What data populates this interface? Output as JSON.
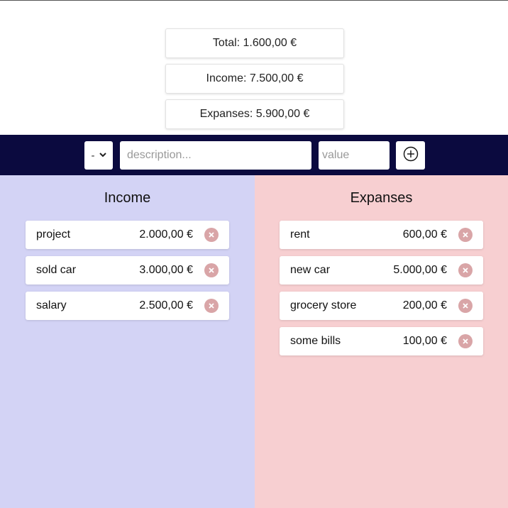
{
  "summary": {
    "total": "Total: 1.600,00 €",
    "income": "Income: 7.500,00 €",
    "expanses": "Expanses: 5.900,00 €"
  },
  "toolbar": {
    "type_selected": "-",
    "description_placeholder": "description...",
    "value_placeholder": "value",
    "add_icon": "plus-circle-icon"
  },
  "income": {
    "title": "Income",
    "items": [
      {
        "description": "project",
        "value": "2.000,00 €"
      },
      {
        "description": "sold car",
        "value": "3.000,00 €"
      },
      {
        "description": "salary",
        "value": "2.500,00 €"
      }
    ]
  },
  "expanses": {
    "title": "Expanses",
    "items": [
      {
        "description": "rent",
        "value": "600,00 €"
      },
      {
        "description": "new car",
        "value": "5.000,00 €"
      },
      {
        "description": "grocery store",
        "value": "200,00 €"
      },
      {
        "description": "some bills",
        "value": "100,00 €"
      }
    ]
  },
  "colors": {
    "toolbar_bg": "#0b0a3f",
    "income_bg": "#d3d3f5",
    "expanses_bg": "#f7cfd1",
    "delete_btn": "#d9a5a7"
  }
}
